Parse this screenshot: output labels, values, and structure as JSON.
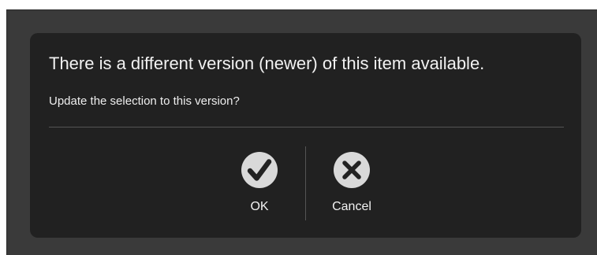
{
  "dialog": {
    "title": "There is a different version (newer) of this item available.",
    "message": "Update the selection to this version?"
  },
  "actions": {
    "ok": {
      "label": "OK",
      "icon": "checkmark-circle-icon"
    },
    "cancel": {
      "label": "Cancel",
      "icon": "x-circle-icon"
    }
  },
  "colors": {
    "dialog_background": "#212121",
    "backdrop": "#3a3a3a",
    "text": "#f2f2f2",
    "icon_fill": "#d9d9d9",
    "icon_glyph": "#222222"
  }
}
